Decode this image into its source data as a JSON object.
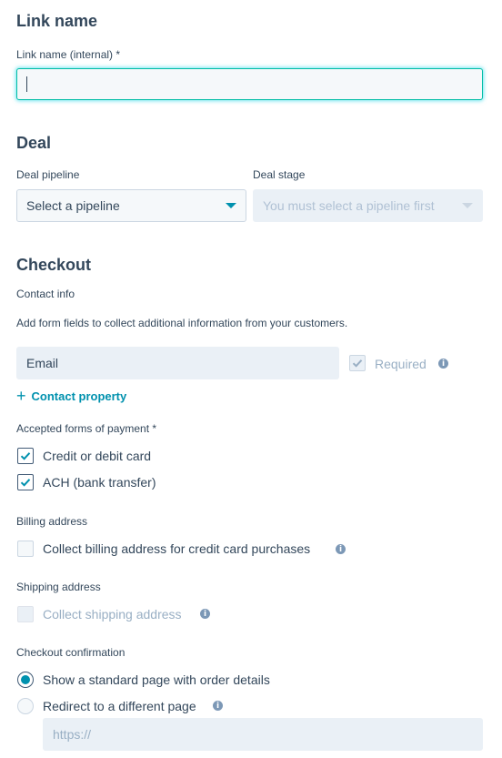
{
  "link_name": {
    "heading": "Link name",
    "field_label": "Link name (internal) *",
    "value": ""
  },
  "deal": {
    "heading": "Deal",
    "pipeline_label": "Deal pipeline",
    "pipeline_value": "Select a pipeline",
    "stage_label": "Deal stage",
    "stage_value": "You must select a pipeline first"
  },
  "checkout": {
    "heading": "Checkout",
    "contact_info_label": "Contact info",
    "contact_info_help": "Add form fields to collect additional information from your customers.",
    "email_field": "Email",
    "required_label": "Required",
    "add_contact_property": "Contact property",
    "payment_label": "Accepted forms of payment *",
    "payment_options": [
      {
        "label": "Credit or debit card",
        "checked": true
      },
      {
        "label": "ACH (bank transfer)",
        "checked": true
      }
    ],
    "billing_label": "Billing address",
    "billing_option": "Collect billing address for credit card purchases",
    "shipping_label": "Shipping address",
    "shipping_option": "Collect shipping address",
    "confirmation_label": "Checkout confirmation",
    "confirmation_options": [
      {
        "label": "Show a standard page with order details",
        "selected": true
      },
      {
        "label": "Redirect to a different page",
        "selected": false
      }
    ],
    "redirect_placeholder": "https://"
  },
  "colors": {
    "accent": "#0091ae",
    "focus": "#00bda5",
    "text": "#33475b",
    "muted": "#99afc4"
  }
}
